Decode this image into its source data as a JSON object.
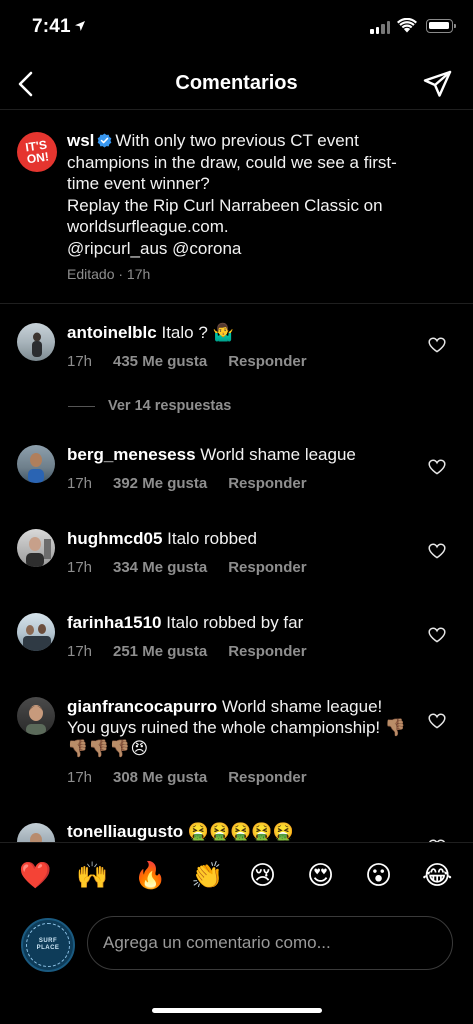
{
  "status": {
    "time": "7:41"
  },
  "nav": {
    "title": "Comentarios"
  },
  "caption": {
    "avatar_text": "IT'S ON!",
    "user": "wsl",
    "text": "With only two previous CT event champions in the draw, could we see a first-time event winner? Replay the Rip Curl Narrabeen Classic on worldsurfleague.com. @ripcurl_aus @corona",
    "lines": [
      "With only two previous CT event",
      "champions in the draw, could we see a first-",
      "time event winner?",
      "Replay the Rip Curl Narrabeen Classic on",
      "worldsurfleague.com.",
      "@ripcurl_aus @corona"
    ],
    "meta": "Editado · 17h"
  },
  "comments": [
    {
      "user": "antoinelblc",
      "text": "Italo ? 🤷‍♂️",
      "time": "17h",
      "likes": "435 Me gusta",
      "reply": "Responder"
    },
    {
      "user": "berg_menesess",
      "text": "World shame league",
      "time": "17h",
      "likes": "392 Me gusta",
      "reply": "Responder"
    },
    {
      "user": "hughmcd05",
      "text": "Italo robbed",
      "time": "17h",
      "likes": "334 Me gusta",
      "reply": "Responder"
    },
    {
      "user": "farinha1510",
      "text": "Italo robbed by far",
      "time": "17h",
      "likes": "251 Me gusta",
      "reply": "Responder"
    },
    {
      "user": "gianfrancocapurro",
      "text": "World shame league! You guys ruined the whole championship! 👎🏽👎🏽👎🏽👎🏽😠",
      "time": "17h",
      "likes": "308 Me gusta",
      "reply": "Responder"
    },
    {
      "user": "tonelliaugusto",
      "text": "🤮🤮🤮🤮🤮"
    }
  ],
  "view_replies": "Ver 14 respuestas",
  "emoji_bar": [
    "❤️",
    "🙌",
    "🔥",
    "👏",
    "😢",
    "😍",
    "😮",
    "😂"
  ],
  "input": {
    "placeholder": "Agrega un comentario como...",
    "avatar_text": "SURF PLACE"
  }
}
